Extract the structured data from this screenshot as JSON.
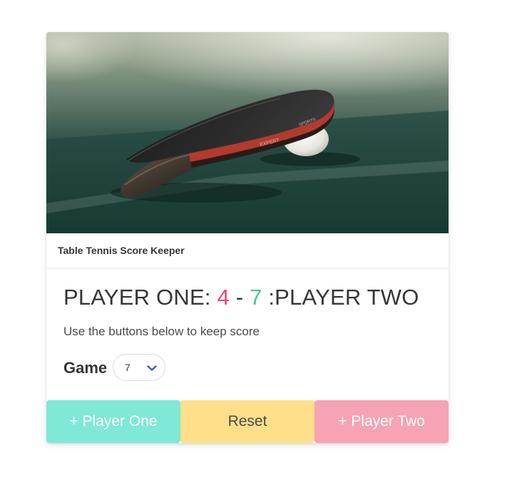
{
  "card": {
    "header_title": "Table Tennis Score Keeper",
    "image_name": "ping-pong-paddle-and-ball-photo"
  },
  "scoreboard": {
    "player_one_label": "PLAYER ONE:",
    "player_one_score": "4",
    "separator": " - ",
    "player_two_score": "7",
    "player_two_label": ":PLAYER TWO"
  },
  "instructions": "Use the buttons below to keep score",
  "game": {
    "label": "Game",
    "selected": "7",
    "icon": "chevron-down-icon"
  },
  "buttons": {
    "player_one": "+ Player One",
    "reset": "Reset",
    "player_two": "+ Player Two"
  },
  "colors": {
    "player_one_score": "#f14668",
    "player_two_score": "#48c78e",
    "player_one_button": "#7fe8d6",
    "reset_button": "#ffdf89",
    "player_two_button": "#f6a3b3",
    "chevron": "#3e56c4"
  }
}
